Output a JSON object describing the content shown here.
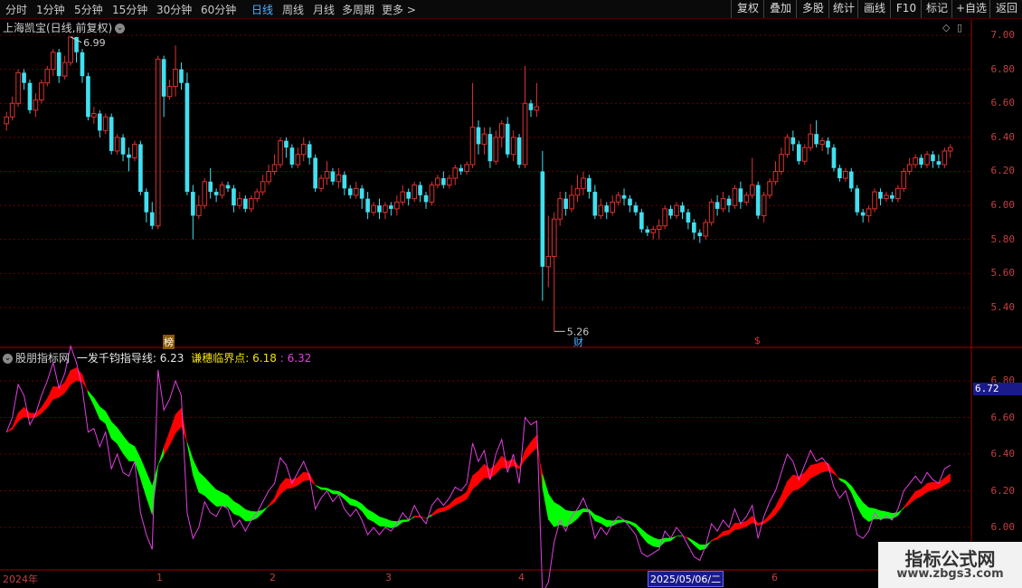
{
  "toolbar": {
    "periods": [
      "分时",
      "1分钟",
      "5分钟",
      "15分钟",
      "30分钟",
      "60分钟",
      "日线",
      "周线",
      "月线",
      "多周期",
      "更多 >"
    ],
    "active_period": "日线",
    "right_buttons": [
      "复权",
      "叠加",
      "多股",
      "统计",
      "画线",
      "F10",
      "标记",
      "+自选",
      "返回"
    ]
  },
  "main_chart": {
    "title": "上海凯宝(日线,前复权)",
    "high_label": "6.99",
    "low_label": "5.26",
    "y_ticks": [
      "7.00",
      "6.80",
      "6.60",
      "6.40",
      "6.20",
      "6.00",
      "5.80",
      "5.60",
      "5.40"
    ],
    "markers": {
      "bang": "榜",
      "cai": "财",
      "dollar": "$"
    },
    "candles": [
      [
        6.48,
        6.52,
        6.44,
        6.55
      ],
      [
        6.52,
        6.6,
        6.5,
        6.64
      ],
      [
        6.6,
        6.78,
        6.58,
        6.8
      ],
      [
        6.78,
        6.72,
        6.68,
        6.8
      ],
      [
        6.72,
        6.56,
        6.54,
        6.74
      ],
      [
        6.56,
        6.62,
        6.52,
        6.66
      ],
      [
        6.62,
        6.72,
        6.6,
        6.74
      ],
      [
        6.72,
        6.8,
        6.7,
        6.82
      ],
      [
        6.8,
        6.9,
        6.76,
        6.92
      ],
      [
        6.9,
        6.76,
        6.72,
        6.92
      ],
      [
        6.76,
        6.84,
        6.74,
        6.88
      ],
      [
        6.84,
        6.99,
        6.82,
        6.99
      ],
      [
        6.99,
        6.9,
        6.84,
        6.99
      ],
      [
        6.9,
        6.76,
        6.72,
        6.92
      ],
      [
        6.76,
        6.52,
        6.5,
        6.78
      ],
      [
        6.52,
        6.54,
        6.48,
        6.58
      ],
      [
        6.54,
        6.44,
        6.4,
        6.56
      ],
      [
        6.44,
        6.52,
        6.42,
        6.54
      ],
      [
        6.52,
        6.32,
        6.3,
        6.54
      ],
      [
        6.32,
        6.4,
        6.3,
        6.42
      ],
      [
        6.4,
        6.3,
        6.26,
        6.42
      ],
      [
        6.3,
        6.28,
        6.2,
        6.34
      ],
      [
        6.28,
        6.36,
        6.26,
        6.38
      ],
      [
        6.36,
        6.08,
        6.06,
        6.38
      ],
      [
        6.08,
        5.96,
        5.9,
        6.1
      ],
      [
        5.96,
        5.88,
        5.86,
        6.02
      ],
      [
        5.88,
        6.86,
        5.86,
        6.88
      ],
      [
        6.86,
        6.64,
        6.52,
        6.88
      ],
      [
        6.64,
        6.7,
        6.62,
        6.74
      ],
      [
        6.7,
        6.8,
        6.64,
        6.94
      ],
      [
        6.8,
        6.72,
        6.68,
        6.84
      ],
      [
        6.72,
        6.08,
        6.06,
        6.78
      ],
      [
        6.08,
        5.94,
        5.8,
        6.12
      ],
      [
        5.94,
        6.0,
        5.92,
        6.06
      ],
      [
        6.0,
        6.14,
        5.98,
        6.16
      ],
      [
        6.14,
        6.08,
        6.04,
        6.22
      ],
      [
        6.08,
        6.06,
        6.02,
        6.1
      ],
      [
        6.06,
        6.12,
        6.04,
        6.14
      ],
      [
        6.12,
        6.1,
        6.08,
        6.14
      ],
      [
        6.1,
        6.0,
        5.96,
        6.12
      ],
      [
        6.0,
        6.04,
        5.98,
        6.08
      ],
      [
        6.04,
        5.98,
        5.96,
        6.06
      ],
      [
        5.98,
        6.04,
        5.96,
        6.06
      ],
      [
        6.04,
        6.08,
        6.02,
        6.1
      ],
      [
        6.08,
        6.14,
        6.06,
        6.18
      ],
      [
        6.14,
        6.2,
        6.12,
        6.24
      ],
      [
        6.2,
        6.24,
        6.18,
        6.3
      ],
      [
        6.24,
        6.38,
        6.22,
        6.4
      ],
      [
        6.38,
        6.34,
        6.28,
        6.4
      ],
      [
        6.34,
        6.24,
        6.22,
        6.36
      ],
      [
        6.24,
        6.3,
        6.22,
        6.34
      ],
      [
        6.3,
        6.36,
        6.26,
        6.4
      ],
      [
        6.36,
        6.28,
        6.24,
        6.38
      ],
      [
        6.28,
        6.1,
        6.08,
        6.3
      ],
      [
        6.1,
        6.16,
        6.08,
        6.18
      ],
      [
        6.16,
        6.2,
        6.12,
        6.26
      ],
      [
        6.2,
        6.14,
        6.12,
        6.22
      ],
      [
        6.14,
        6.18,
        6.1,
        6.22
      ],
      [
        6.18,
        6.1,
        6.06,
        6.2
      ],
      [
        6.1,
        6.06,
        6.04,
        6.12
      ],
      [
        6.06,
        6.1,
        6.04,
        6.14
      ],
      [
        6.1,
        6.04,
        5.98,
        6.12
      ],
      [
        6.04,
        5.96,
        5.92,
        6.08
      ],
      [
        5.96,
        6.0,
        5.94,
        6.02
      ],
      [
        6.0,
        5.96,
        5.92,
        6.04
      ],
      [
        5.96,
        6.0,
        5.92,
        6.02
      ],
      [
        6.0,
        5.98,
        5.94,
        6.02
      ],
      [
        5.98,
        6.02,
        5.94,
        6.06
      ],
      [
        6.02,
        6.08,
        6.0,
        6.12
      ],
      [
        6.08,
        6.04,
        6.0,
        6.1
      ],
      [
        6.04,
        6.12,
        6.02,
        6.14
      ],
      [
        6.12,
        6.06,
        6.02,
        6.14
      ],
      [
        6.06,
        6.02,
        5.98,
        6.08
      ],
      [
        6.02,
        6.12,
        6.0,
        6.14
      ],
      [
        6.12,
        6.16,
        6.1,
        6.18
      ],
      [
        6.16,
        6.12,
        6.1,
        6.2
      ],
      [
        6.12,
        6.16,
        6.1,
        6.18
      ],
      [
        6.16,
        6.22,
        6.12,
        6.24
      ],
      [
        6.22,
        6.2,
        6.18,
        6.24
      ],
      [
        6.2,
        6.24,
        6.18,
        6.26
      ],
      [
        6.24,
        6.46,
        6.22,
        6.72
      ],
      [
        6.46,
        6.36,
        6.3,
        6.5
      ],
      [
        6.36,
        6.42,
        6.3,
        6.46
      ],
      [
        6.42,
        6.26,
        6.22,
        6.46
      ],
      [
        6.26,
        6.4,
        6.24,
        6.44
      ],
      [
        6.4,
        6.48,
        6.34,
        6.5
      ],
      [
        6.48,
        6.3,
        6.28,
        6.52
      ],
      [
        6.3,
        6.4,
        6.26,
        6.44
      ],
      [
        6.4,
        6.24,
        6.22,
        6.42
      ],
      [
        6.24,
        6.6,
        6.22,
        6.82
      ],
      [
        6.6,
        6.56,
        6.52,
        6.62
      ],
      [
        6.56,
        6.58,
        6.52,
        6.72
      ],
      [
        6.2,
        5.64,
        5.44,
        6.32
      ],
      [
        5.64,
        5.7,
        5.52,
        5.94
      ],
      [
        5.7,
        5.92,
        5.26,
        5.96
      ],
      [
        5.92,
        6.04,
        5.88,
        6.08
      ],
      [
        6.04,
        5.98,
        5.94,
        6.08
      ],
      [
        5.98,
        6.06,
        5.96,
        6.12
      ],
      [
        6.06,
        6.1,
        6.02,
        6.18
      ],
      [
        6.1,
        6.16,
        6.06,
        6.2
      ],
      [
        6.16,
        6.08,
        6.04,
        6.18
      ],
      [
        6.08,
        5.94,
        5.92,
        6.12
      ],
      [
        5.94,
        6.0,
        5.92,
        6.04
      ],
      [
        6.0,
        5.96,
        5.92,
        6.02
      ],
      [
        5.96,
        6.02,
        5.94,
        6.06
      ],
      [
        6.02,
        6.06,
        6.0,
        6.08
      ],
      [
        6.06,
        6.04,
        6.0,
        6.1
      ],
      [
        6.04,
        6.0,
        5.96,
        6.06
      ],
      [
        6.0,
        5.96,
        5.94,
        6.02
      ],
      [
        5.96,
        5.86,
        5.84,
        5.98
      ],
      [
        5.86,
        5.84,
        5.82,
        5.88
      ],
      [
        5.84,
        5.86,
        5.8,
        5.88
      ],
      [
        5.86,
        5.88,
        5.8,
        5.92
      ],
      [
        5.88,
        5.98,
        5.86,
        6.0
      ],
      [
        5.98,
        5.94,
        5.92,
        6.0
      ],
      [
        5.94,
        6.0,
        5.92,
        6.02
      ],
      [
        6.0,
        5.96,
        5.92,
        6.02
      ],
      [
        5.96,
        5.9,
        5.86,
        5.98
      ],
      [
        5.9,
        5.84,
        5.8,
        5.92
      ],
      [
        5.84,
        5.82,
        5.78,
        5.86
      ],
      [
        5.82,
        5.9,
        5.8,
        5.92
      ],
      [
        5.9,
        6.02,
        5.88,
        6.04
      ],
      [
        6.02,
        5.98,
        5.94,
        6.06
      ],
      [
        5.98,
        6.04,
        5.96,
        6.08
      ],
      [
        6.04,
        6.0,
        5.96,
        6.06
      ],
      [
        6.0,
        6.1,
        5.98,
        6.12
      ],
      [
        6.1,
        6.02,
        5.98,
        6.14
      ],
      [
        6.02,
        6.06,
        6.0,
        6.08
      ],
      [
        6.06,
        6.12,
        6.04,
        6.28
      ],
      [
        6.12,
        5.94,
        5.92,
        6.14
      ],
      [
        5.94,
        6.06,
        5.9,
        6.08
      ],
      [
        6.06,
        6.14,
        6.04,
        6.16
      ],
      [
        6.14,
        6.2,
        6.12,
        6.26
      ],
      [
        6.2,
        6.3,
        6.18,
        6.34
      ],
      [
        6.3,
        6.4,
        6.28,
        6.42
      ],
      [
        6.4,
        6.36,
        6.32,
        6.44
      ],
      [
        6.36,
        6.26,
        6.24,
        6.38
      ],
      [
        6.26,
        6.34,
        6.24,
        6.36
      ],
      [
        6.34,
        6.42,
        6.32,
        6.48
      ],
      [
        6.42,
        6.36,
        6.34,
        6.5
      ],
      [
        6.36,
        6.38,
        6.32,
        6.4
      ],
      [
        6.38,
        6.34,
        6.3,
        6.4
      ],
      [
        6.34,
        6.22,
        6.2,
        6.36
      ],
      [
        6.22,
        6.16,
        6.14,
        6.24
      ],
      [
        6.16,
        6.2,
        6.14,
        6.22
      ],
      [
        6.2,
        6.1,
        6.08,
        6.22
      ],
      [
        6.1,
        5.96,
        5.94,
        6.12
      ],
      [
        5.96,
        5.94,
        5.9,
        5.98
      ],
      [
        5.94,
        5.98,
        5.9,
        6.0
      ],
      [
        5.98,
        6.08,
        5.96,
        6.1
      ],
      [
        6.08,
        6.04,
        6.0,
        6.1
      ],
      [
        6.04,
        6.06,
        6.02,
        6.08
      ],
      [
        6.06,
        6.04,
        6.02,
        6.08
      ],
      [
        6.04,
        6.1,
        6.02,
        6.12
      ],
      [
        6.1,
        6.2,
        6.08,
        6.22
      ],
      [
        6.2,
        6.24,
        6.18,
        6.28
      ],
      [
        6.24,
        6.28,
        6.22,
        6.3
      ],
      [
        6.28,
        6.24,
        6.22,
        6.3
      ],
      [
        6.24,
        6.3,
        6.22,
        6.32
      ],
      [
        6.3,
        6.26,
        6.22,
        6.32
      ],
      [
        6.26,
        6.24,
        6.22,
        6.3
      ],
      [
        6.24,
        6.32,
        6.22,
        6.34
      ],
      [
        6.32,
        6.34,
        6.28,
        6.36
      ]
    ]
  },
  "indicator": {
    "title": "股朋指标网",
    "line1_label": "一发千钧指导线:",
    "line1_value": "6.23",
    "line2_label": "谦穗临界点:",
    "line2_value": "6.18",
    "line3_sep": ":",
    "line3_value": "6.32",
    "y_ticks": [
      "6.80",
      "6.60",
      "6.40",
      "6.20",
      "6.00"
    ],
    "last_value_badge": "6.72"
  },
  "date_axis": {
    "labels": [
      "2024年",
      "1",
      "2",
      "3",
      "4",
      "6"
    ],
    "cursor_date": "2025/05/06/二"
  },
  "watermark": {
    "line1": "指标公式网",
    "line2": "www.zbgs3.com"
  },
  "colors": {
    "up": "#e03030",
    "down": "#40e0f0",
    "band_up": "#ff0000",
    "band_down": "#00ff00",
    "price_line": "#e040e0",
    "active_tab": "#4fb0ff"
  }
}
